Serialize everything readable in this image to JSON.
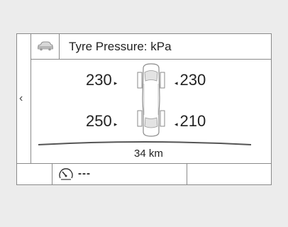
{
  "header": {
    "title": "Tyre Pressure: kPa",
    "icon": "car-icon"
  },
  "tyres": {
    "front_left": "230",
    "front_right": "230",
    "rear_left": "250",
    "rear_right": "210"
  },
  "distance": "34 km",
  "bottom_bar": {
    "gauge_icon": "speedometer-icon",
    "value": "---"
  },
  "nav": {
    "back_icon": "chevron-left-icon",
    "back_glyph": "‹"
  }
}
